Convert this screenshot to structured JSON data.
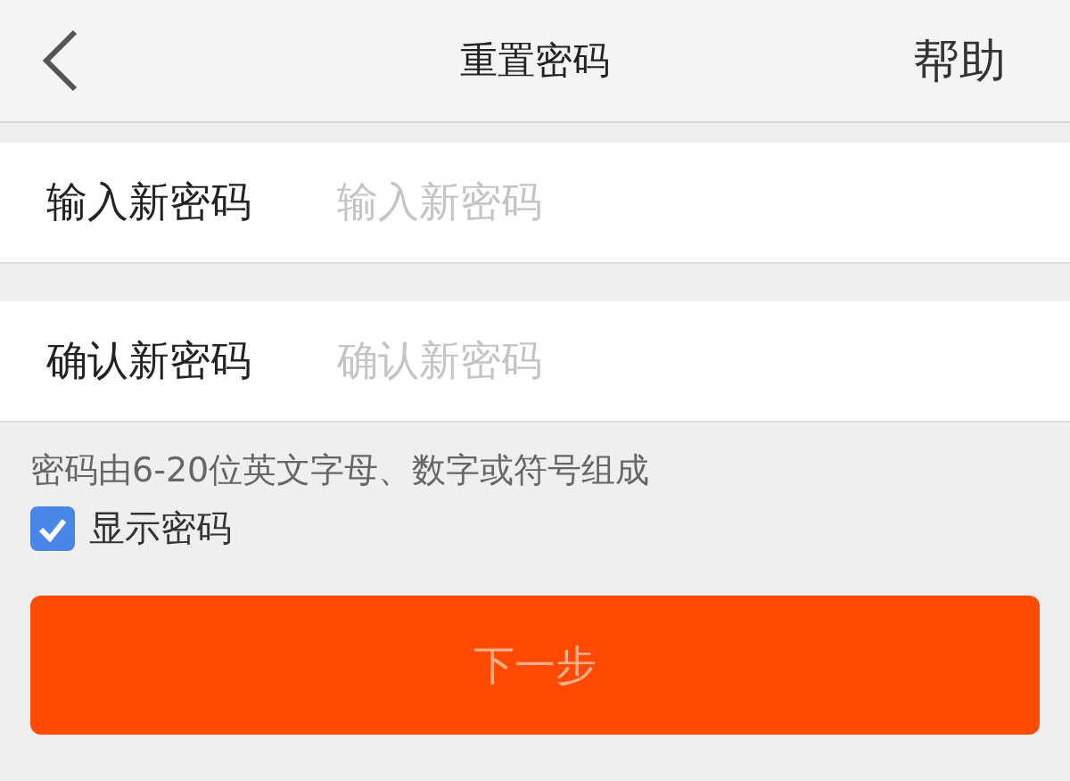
{
  "header": {
    "title": "重置密码",
    "action": "帮助"
  },
  "fields": [
    {
      "label": "输入新密码",
      "placeholder": "输入新密码"
    },
    {
      "label": "确认新密码",
      "placeholder": "确认新密码"
    }
  ],
  "hint": "密码由6-20位英文字母、数字或符号组成",
  "show_password": {
    "label": "显示密码",
    "checked": true
  },
  "next_button": {
    "label": "下一步",
    "disabled": true
  }
}
